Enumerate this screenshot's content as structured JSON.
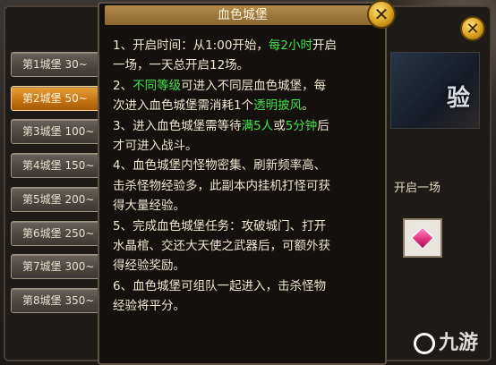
{
  "castle_list": [
    {
      "label": "第1城堡 30~",
      "active": false
    },
    {
      "label": "第2城堡 50~",
      "active": true
    },
    {
      "label": "第3城堡 100~",
      "active": false
    },
    {
      "label": "第4城堡 150~",
      "active": false
    },
    {
      "label": "第5城堡 200~",
      "active": false
    },
    {
      "label": "第6城堡 250~",
      "active": false
    },
    {
      "label": "第7城堡 300~",
      "active": false
    },
    {
      "label": "第8城堡 350~",
      "active": false
    }
  ],
  "tooltip": {
    "title": "血色城堡",
    "close_glyph": "✕",
    "lines": [
      [
        {
          "t": "1、开启时间：从1:00开始，"
        },
        {
          "t": "每2小时",
          "g": true
        },
        {
          "t": "开启"
        }
      ],
      [
        {
          "t": "一场，一天总开启12场。"
        }
      ],
      [
        {
          "t": "2、"
        },
        {
          "t": "不同等级",
          "g": true
        },
        {
          "t": "可进入不同层血色城堡，每"
        }
      ],
      [
        {
          "t": "次进入血色城堡需消耗1个"
        },
        {
          "t": "透明披风",
          "g": true
        },
        {
          "t": "。"
        }
      ],
      [
        {
          "t": "3、进入血色城堡需等待"
        },
        {
          "t": "满5人",
          "g": true
        },
        {
          "t": "或"
        },
        {
          "t": "5分钟",
          "g": true
        },
        {
          "t": "后"
        }
      ],
      [
        {
          "t": "才可进入战斗。"
        }
      ],
      [
        {
          "t": "4、血色城堡内怪物密集、刷新频率高、"
        }
      ],
      [
        {
          "t": "击杀怪物经验多，此副本内挂机打怪可获"
        }
      ],
      [
        {
          "t": "得大量经验。"
        }
      ],
      [
        {
          "t": "5、完成血色城堡任务：攻破城门、打开"
        }
      ],
      [
        {
          "t": "水晶棺、交还大天使之武器后，可额外获"
        }
      ],
      [
        {
          "t": "得经验奖励。"
        }
      ],
      [
        {
          "t": "6、血色城堡可组队一起进入，击杀怪物"
        }
      ],
      [
        {
          "t": "经验将平分。"
        }
      ]
    ]
  },
  "background": {
    "banner_text": "验",
    "side_text": "开启一场",
    "back_close_glyph": "✕"
  },
  "watermark": {
    "text": "九游"
  }
}
